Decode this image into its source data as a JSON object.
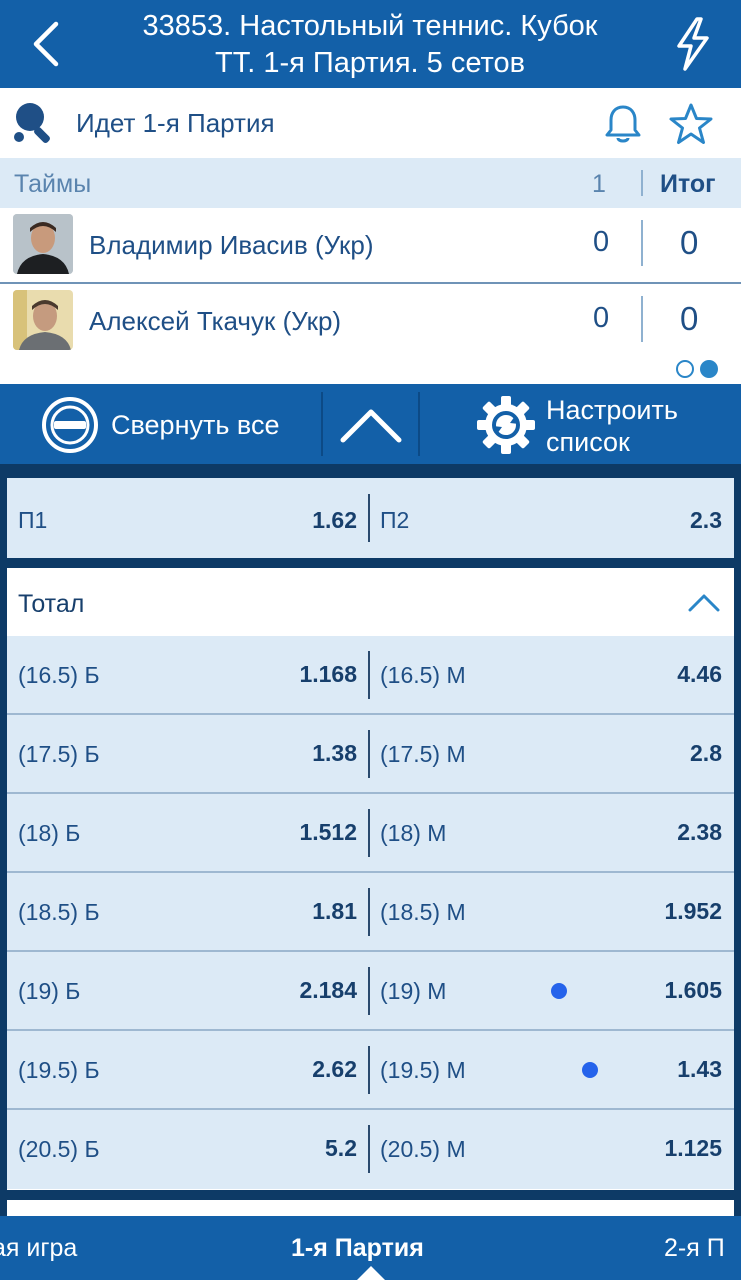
{
  "header": {
    "title_line1": "33853. Настольный теннис. Кубок",
    "title_line2": "ТТ. 1-я  Партия. 5 сетов"
  },
  "status": {
    "text": "Идет 1-я  Партия"
  },
  "scoreboard": {
    "label": "Таймы",
    "set_header": "1",
    "total_header": "Итог",
    "players": [
      {
        "name": "Владимир Ивасив (Укр)",
        "set": "0",
        "total": "0"
      },
      {
        "name": "Алексей Ткачук (Укр)",
        "set": "0",
        "total": "0"
      }
    ],
    "page_indicator": {
      "pages": 2,
      "active": 2
    }
  },
  "toolbar": {
    "collapse_label": "Свернуть все",
    "config_label_line1": "Настроить",
    "config_label_line2": "список"
  },
  "outcome_1x2": {
    "left_label": "П1",
    "left_value": "1.62",
    "right_label": "П2",
    "right_value": "2.3"
  },
  "total": {
    "title": "Тотал",
    "rows": [
      {
        "left_label": "(16.5) Б",
        "left_value": "1.168",
        "right_label": "(16.5) М",
        "right_value": "4.46"
      },
      {
        "left_label": "(17.5) Б",
        "left_value": "1.38",
        "right_label": "(17.5) М",
        "right_value": "2.8"
      },
      {
        "left_label": "(18) Б",
        "left_value": "1.512",
        "right_label": "(18) М",
        "right_value": "2.38"
      },
      {
        "left_label": "(18.5) Б",
        "left_value": "1.81",
        "right_label": "(18.5) М",
        "right_value": "1.952"
      },
      {
        "left_label": "(19) Б",
        "left_value": "2.184",
        "right_label": "(19) М",
        "right_value": "1.605"
      },
      {
        "left_label": "(19.5) Б",
        "left_value": "2.62",
        "right_label": "(19.5) М",
        "right_value": "1.43"
      },
      {
        "left_label": "(20.5) Б",
        "left_value": "5.2",
        "right_label": "(20.5) М",
        "right_value": "1.125"
      }
    ]
  },
  "tabs": {
    "items": [
      "ая игра",
      "1-я  Партия",
      "2-я  П"
    ],
    "active_index": 1
  },
  "colors": {
    "brand_blue": "#1360a8",
    "dark_navy": "#0d3a66",
    "light_row": "#dceaf6",
    "text_blue": "#1f4f86",
    "touch_dot": "#2563eb"
  }
}
